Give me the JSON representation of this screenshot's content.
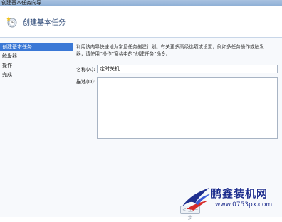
{
  "window": {
    "title": "创建基本任务向导"
  },
  "header": {
    "title": "创建基本任务"
  },
  "sidebar": {
    "items": [
      {
        "label": "创建基本任务",
        "active": true
      },
      {
        "label": "触发器",
        "active": false
      },
      {
        "label": "操作",
        "active": false
      },
      {
        "label": "完成",
        "active": false
      }
    ]
  },
  "content": {
    "description_line1": "利用该向导快速地为常见任务创建计划。有关更多高级选项或设置，例如多任务操作或触发",
    "description_line2": "器，请使用“操作”窗格中的“创建任务”命令。",
    "name_label": "名称(A):",
    "name_value": "定时关机",
    "desc_label": "描述(D):",
    "desc_value": ""
  },
  "footer": {
    "back_label": "< 上一步"
  },
  "watermark": {
    "brand": "鹏鑫装机网",
    "url": "www.0753px.com"
  },
  "colors": {
    "accent": "#3a78d6",
    "watermark": "#1f2f8f"
  }
}
